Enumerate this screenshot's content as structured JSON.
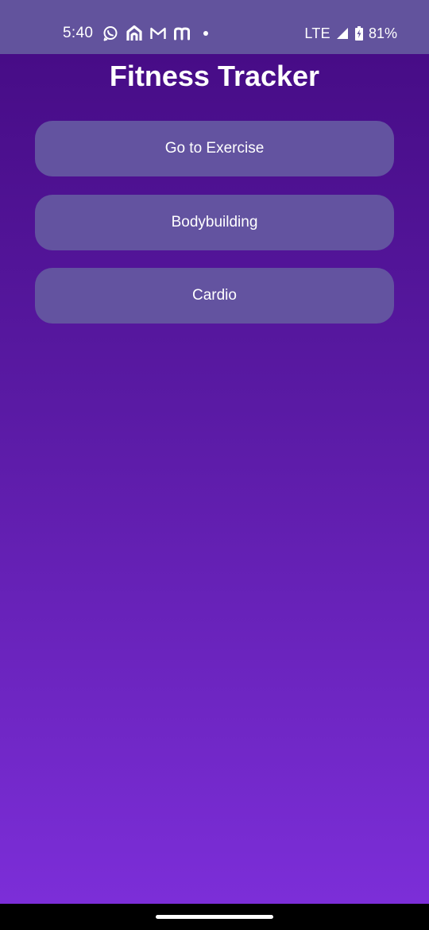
{
  "status_bar": {
    "time": "5:40",
    "network": "LTE",
    "battery": "81%",
    "notification_icons": [
      "whatsapp-icon",
      "home-app-icon",
      "gmail-icon",
      "m-app-icon"
    ]
  },
  "page": {
    "title": "Fitness Tracker"
  },
  "menu": {
    "buttons": [
      {
        "label": "Go to Exercise"
      },
      {
        "label": "Bodybuilding"
      },
      {
        "label": "Cardio"
      }
    ]
  },
  "colors": {
    "status_bar_bg": "#62539d",
    "gradient_top": "#440a82",
    "gradient_bottom": "#7c2ed8",
    "button_bg": "#6353a0",
    "text": "#ffffff"
  }
}
